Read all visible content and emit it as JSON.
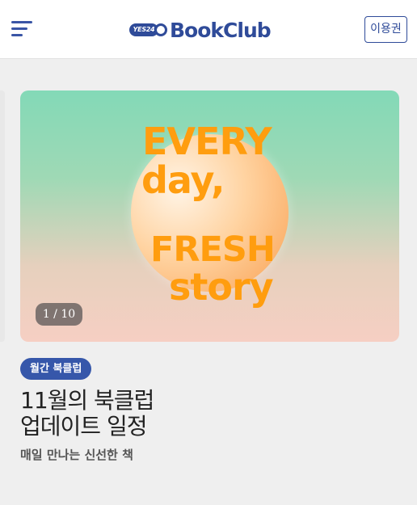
{
  "header": {
    "logo": {
      "pill_text": "YES24",
      "name": "BookClub"
    },
    "usage_button": "이용권"
  },
  "banner": {
    "art_lines": [
      "EVERY",
      "day,",
      "FRESH",
      "story"
    ],
    "counter": "1 / 10"
  },
  "article": {
    "badge": "월간 북클럽",
    "title_line1": "11월의 북클럽",
    "title_line2": "업데이트 일정",
    "subtitle": "매일 만나는 신선한 책"
  },
  "colors": {
    "brand": "#2f4b99",
    "accent_orange": "#ff9d0f",
    "badge_bg": "#3657aa"
  }
}
